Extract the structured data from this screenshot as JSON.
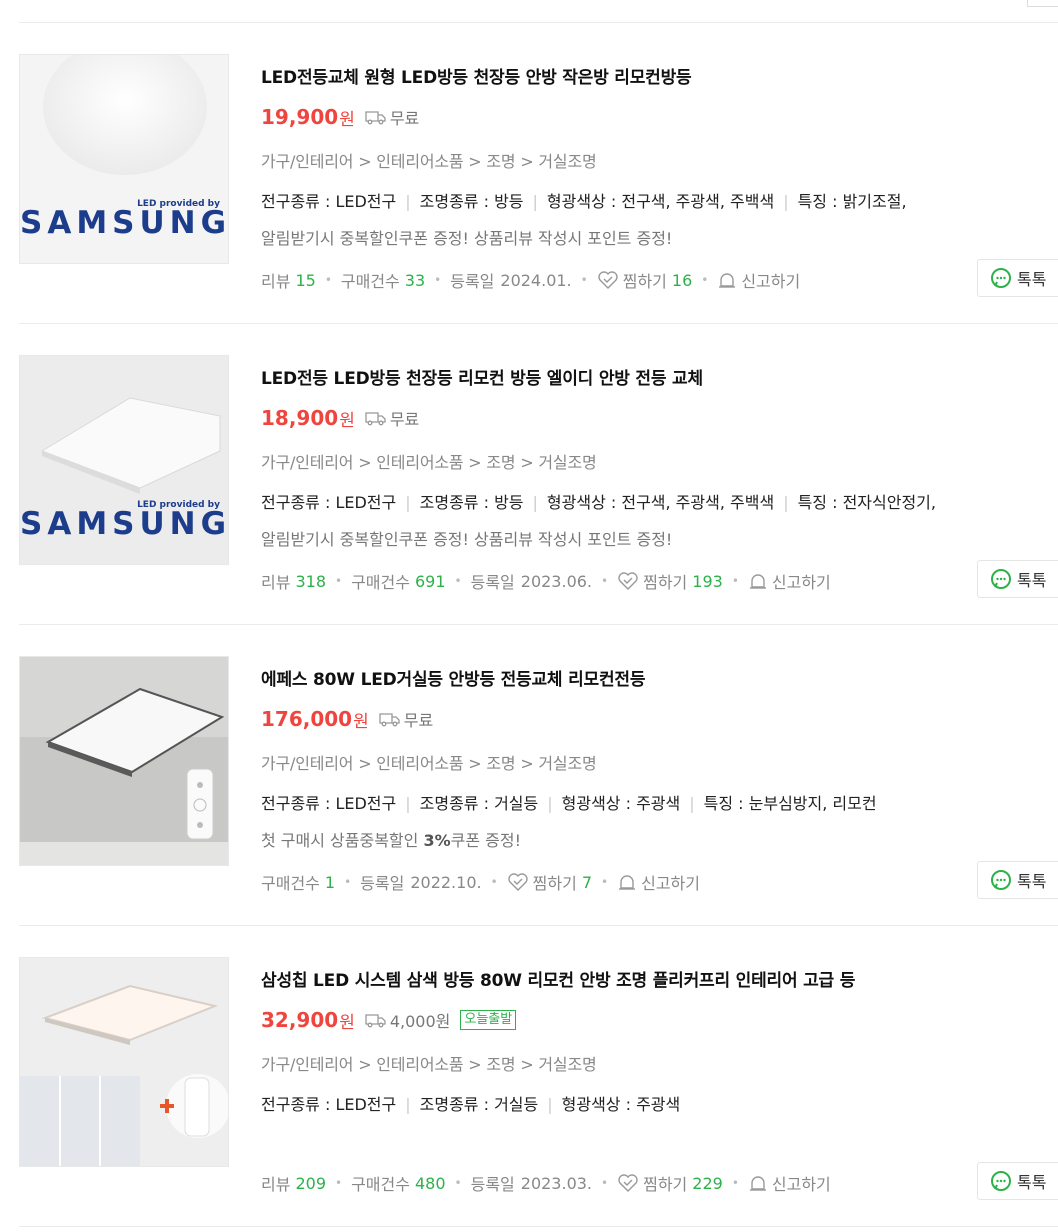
{
  "products": [
    {
      "title": "LED전등교체 원형 LED방등 천장등 안방 작은방 리모컨방등",
      "price": "19,900",
      "won": "원",
      "shipping": "무료",
      "badge": "",
      "category": "가구/인테리어 > 인테리어소품 > 조명 > 거실조명",
      "specs": [
        "전구종류 : LED전구",
        "조명종류 : 방등",
        "형광색상 : 전구색, 주광색, 주백색",
        "특징 : 밝기조절,"
      ],
      "promo": "알림받기시 중복할인쿠폰 증정! 상품리뷰 작성시 포인트 증정!",
      "review_label": "리뷰",
      "review_count": "15",
      "purchase_label": "구매건수",
      "purchase_count": "33",
      "date_label": "등록일",
      "date": "2024.01.",
      "wish_label": "찜하기",
      "wish_count": "16",
      "report_label": "신고하기",
      "talk_label": "톡톡",
      "image_brand": "SAMSUNG",
      "image_tag": "LED provided by",
      "image_icon": "round-ceiling-lamp"
    },
    {
      "title": "LED전등 LED방등 천장등 리모컨 방등 엘이디 안방 전등 교체",
      "price": "18,900",
      "won": "원",
      "shipping": "무료",
      "badge": "",
      "category": "가구/인테리어 > 인테리어소품 > 조명 > 거실조명",
      "specs": [
        "전구종류 : LED전구",
        "조명종류 : 방등",
        "형광색상 : 전구색, 주광색, 주백색",
        "특징 : 전자식안정기,"
      ],
      "promo": "알림받기시 중복할인쿠폰 증정! 상품리뷰 작성시 포인트 증정!",
      "review_label": "리뷰",
      "review_count": "318",
      "purchase_label": "구매건수",
      "purchase_count": "691",
      "date_label": "등록일",
      "date": "2023.06.",
      "wish_label": "찜하기",
      "wish_count": "193",
      "report_label": "신고하기",
      "talk_label": "톡톡",
      "image_brand": "SAMSUNG",
      "image_tag": "LED provided by",
      "image_icon": "square-ceiling-lamp"
    },
    {
      "title": "에페스 80W LED거실등 안방등 전등교체 리모컨전등",
      "price": "176,000",
      "won": "원",
      "shipping": "무료",
      "badge": "",
      "category": "가구/인테리어 > 인테리어소품 > 조명 > 거실조명",
      "specs": [
        "전구종류 : LED전구",
        "조명종류 : 거실등",
        "형광색상 : 주광색",
        "특징 : 눈부심방지, 리모컨"
      ],
      "promo_pre": "첫 구매시 상품중복할인 ",
      "promo_bold": "3%",
      "promo_post": "쿠폰 증정!",
      "purchase_label": "구매건수",
      "purchase_count": "1",
      "date_label": "등록일",
      "date": "2022.10.",
      "wish_label": "찜하기",
      "wish_count": "7",
      "report_label": "신고하기",
      "talk_label": "톡톡",
      "image_icon": "square-lamp-with-remote"
    },
    {
      "title": "삼성칩 LED 시스템 삼색 방등 80W 리모컨 안방 조명 플리커프리 인테리어 고급 등",
      "price": "32,900",
      "won": "원",
      "shipping": "4,000원",
      "badge": "오늘출발",
      "category": "가구/인테리어 > 인테리어소품 > 조명 > 거실조명",
      "specs": [
        "전구종류 : LED전구",
        "조명종류 : 거실등",
        "형광색상 : 주광색"
      ],
      "review_label": "리뷰",
      "review_count": "209",
      "purchase_label": "구매건수",
      "purchase_count": "480",
      "date_label": "등록일",
      "date": "2023.03.",
      "wish_label": "찜하기",
      "wish_count": "229",
      "report_label": "신고하기",
      "talk_label": "톡톡",
      "image_icon": "square-lamp-room-with-remote"
    }
  ],
  "colors": {
    "price": "#f0453e",
    "count": "#2db24a",
    "brand": "#1c3c8c"
  }
}
